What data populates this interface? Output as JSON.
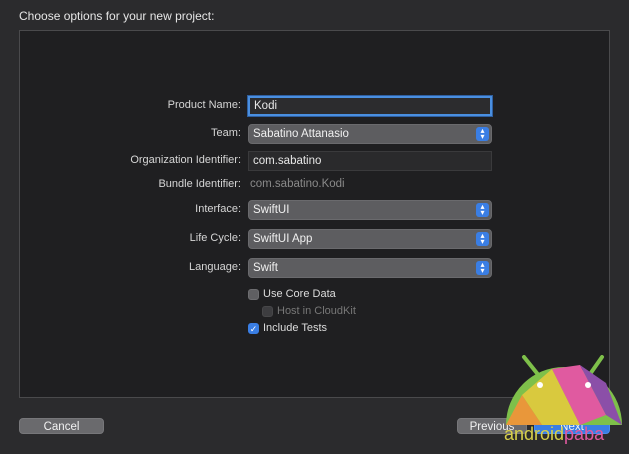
{
  "header": {
    "title": "Choose options for your new project:"
  },
  "form": {
    "product_name": {
      "label": "Product Name:",
      "value": "Kodi"
    },
    "team": {
      "label": "Team:",
      "value": "Sabatino Attanasio"
    },
    "org_identifier": {
      "label": "Organization Identifier:",
      "value": "com.sabatino"
    },
    "bundle_identifier": {
      "label": "Bundle Identifier:",
      "value": "com.sabatino.Kodi"
    },
    "interface": {
      "label": "Interface:",
      "value": "SwiftUI"
    },
    "life_cycle": {
      "label": "Life Cycle:",
      "value": "SwiftUI App"
    },
    "language": {
      "label": "Language:",
      "value": "Swift"
    },
    "use_core_data": {
      "label": "Use Core Data",
      "checked": false
    },
    "host_in_cloudkit": {
      "label": "Host in CloudKit",
      "checked": false,
      "enabled": false
    },
    "include_tests": {
      "label": "Include Tests",
      "checked": true
    }
  },
  "footer": {
    "cancel_label": "Cancel",
    "previous_label": "Previous",
    "next_label": "Next"
  },
  "watermark": {
    "text_a": "android",
    "text_b": "paba"
  },
  "colors": {
    "accent": "#3a7ee4",
    "background": "#2b2b2d",
    "panel": "#1f1f21"
  }
}
